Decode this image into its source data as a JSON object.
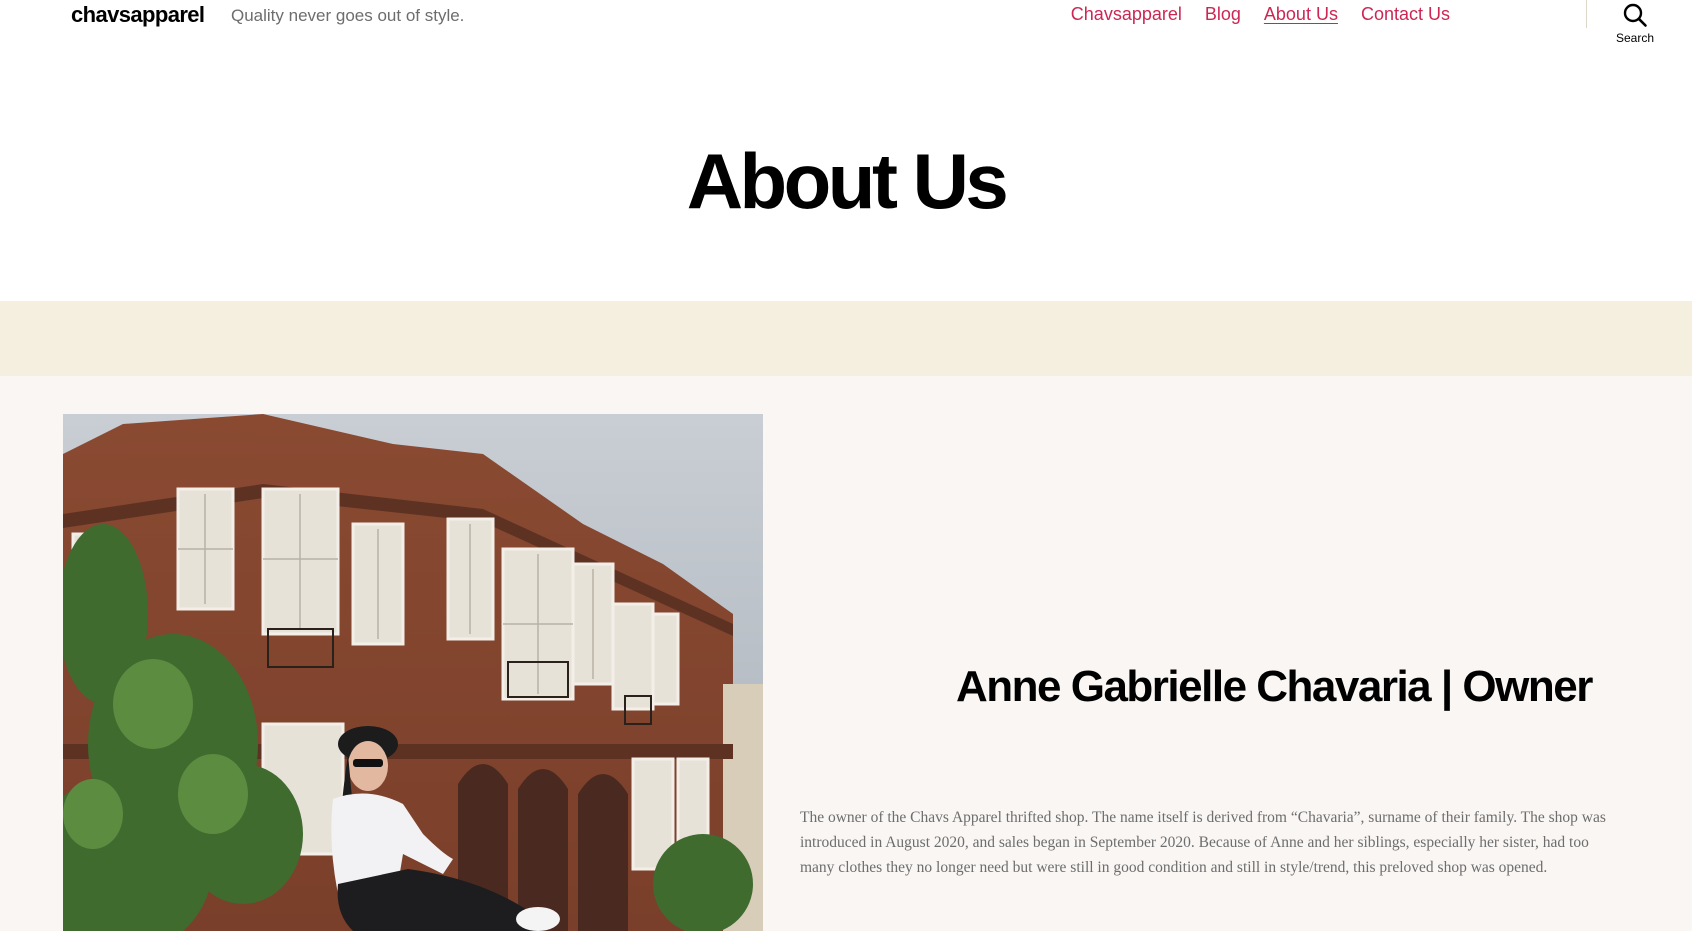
{
  "header": {
    "site_title": "chavsapparel",
    "tagline": "Quality never goes out of style.",
    "nav": [
      {
        "label": "Chavsapparel",
        "current": false
      },
      {
        "label": "Blog",
        "current": false
      },
      {
        "label": "About Us",
        "current": true
      },
      {
        "label": "Contact Us",
        "current": false
      }
    ],
    "search_label": "Search",
    "search_icon": "search-icon"
  },
  "page": {
    "title": "About Us"
  },
  "owner": {
    "photo_icon": "owner-photo",
    "name": "Anne Gabrielle Chavaria | Owner",
    "bio": "The owner of the Chavs Apparel thrifted shop. The name itself is derived from “Chavaria”, surname of their family. The shop was introduced in August 2020, and sales began in September 2020. Because of Anne and her siblings, especially her sister, had too many clothes they no longer need but were still in good condition and still in style/trend, this preloved shop was opened."
  },
  "colors": {
    "accent": "#cd2653",
    "band": "#f5efe0",
    "section_bg": "#f9f6f4",
    "muted_text": "#6d6d6d"
  }
}
